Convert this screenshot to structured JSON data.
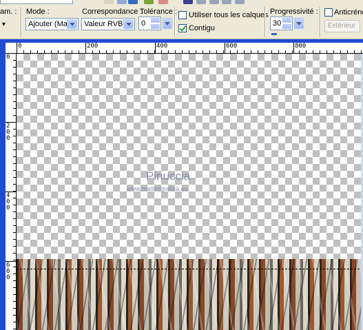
{
  "toolbar": {
    "partial_label": "am. :",
    "mode": {
      "label": "Mode :",
      "value": "Ajouter (Maj)"
    },
    "correspondance": {
      "label": "Correspondance :",
      "value": "Valeur RVB"
    },
    "tolerance": {
      "label": "Tolérance :",
      "value": "0"
    },
    "use_all_layers": {
      "label": "Utiliser tous les calques",
      "checked": false
    },
    "contigu": {
      "label": "Contigu",
      "checked": true
    },
    "progressivite": {
      "label": "Progressivité :",
      "value": "30"
    },
    "anticrenel": {
      "label": "Anticrénel",
      "checked": false
    },
    "exterieur_button": "Extérieur"
  },
  "ruler": {
    "horizontal_labels": [
      "0",
      "200",
      "400",
      "600",
      "800"
    ],
    "vertical_labels": [
      "0",
      "200",
      "400",
      "600"
    ]
  },
  "watermark": {
    "name": "Pinuccia",
    "url": "www.madiregrafica.eu"
  },
  "colors": {
    "workspace": "#1e4bd1",
    "chrome": "#ece9d8",
    "accent": "#316ac5"
  }
}
